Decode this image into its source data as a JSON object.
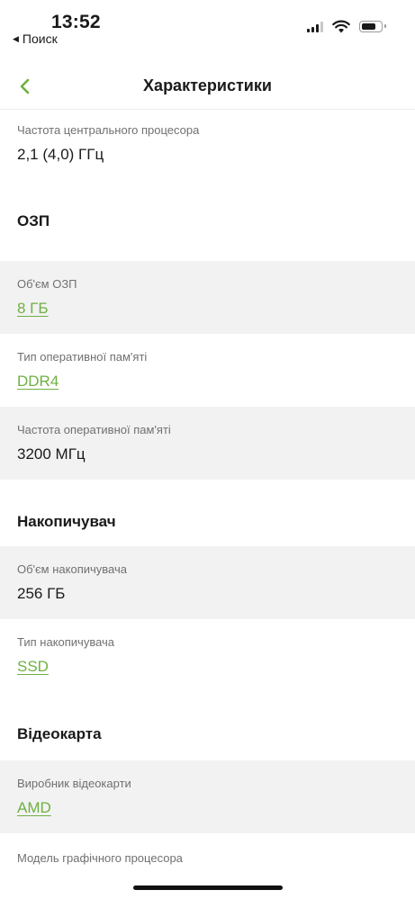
{
  "status_bar": {
    "time": "13:52",
    "back_app": "Поиск",
    "icons": [
      "cellular-signal-icon",
      "wifi-icon",
      "battery-icon"
    ]
  },
  "nav": {
    "title": "Характеристики",
    "back_icon": "chevron-left-icon"
  },
  "colors": {
    "accent": "#6fb042",
    "row_gray": "#f2f2f2",
    "label": "#707070",
    "text": "#1a1a1a"
  },
  "rows": {
    "cpu_freq": {
      "label": "Частота центрального процесора",
      "value": "2,1 (4,0) ГГц"
    },
    "ram_size": {
      "label": "Об'єм ОЗП",
      "value": "8 ГБ"
    },
    "ram_type": {
      "label": "Тип оперативної пам'яті",
      "value": "DDR4"
    },
    "ram_freq": {
      "label": "Частота оперативної пам'яті",
      "value": "3200 МГц"
    },
    "storage_size": {
      "label": "Об'єм накопичувача",
      "value": "256 ГБ"
    },
    "storage_type": {
      "label": "Тип накопичувача",
      "value": "SSD"
    },
    "gpu_vendor": {
      "label": "Виробник відеокарти",
      "value": "AMD"
    },
    "gpu_model": {
      "label": "Модель графічного процесора"
    }
  },
  "sections": {
    "ram": "ОЗП",
    "storage": "Накопичувач",
    "gpu": "Відеокарта"
  }
}
